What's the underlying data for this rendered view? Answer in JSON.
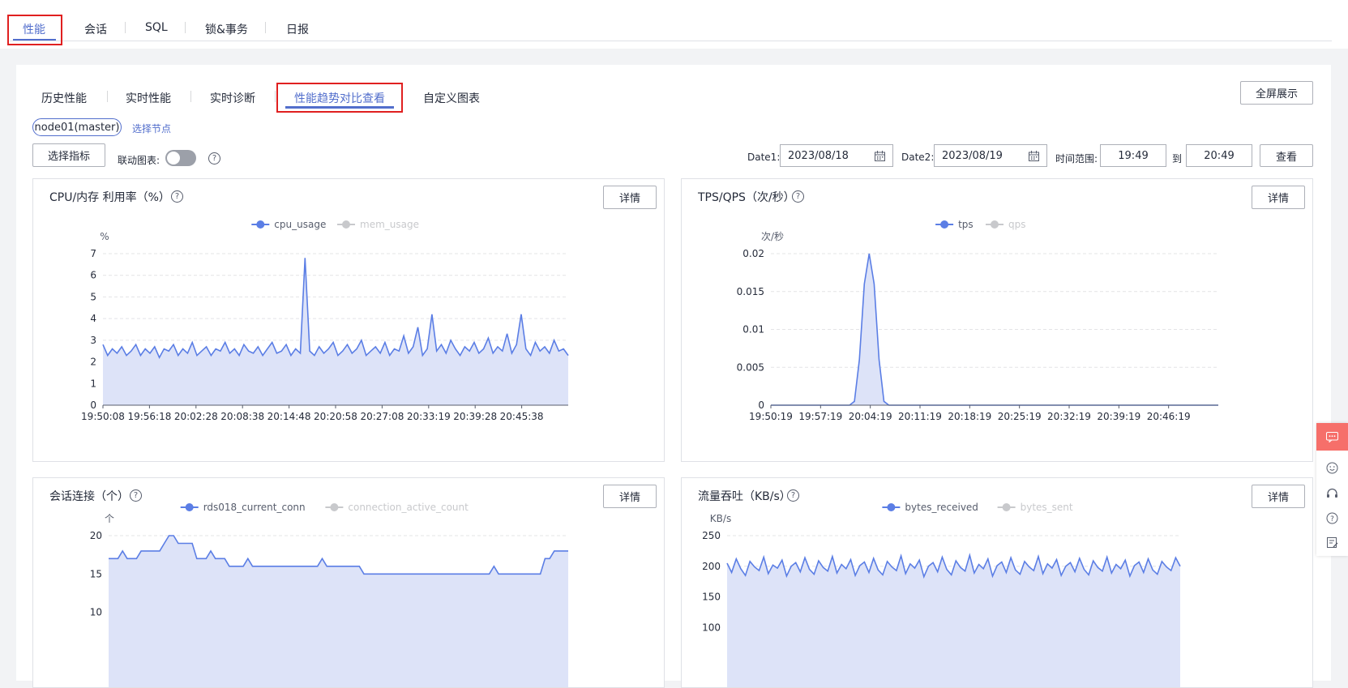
{
  "top_tabs": [
    "性能",
    "会话",
    "SQL",
    "锁&事务",
    "日报"
  ],
  "sub_tabs": [
    "历史性能",
    "实时性能",
    "实时诊断",
    "性能趋势对比查看",
    "自定义图表"
  ],
  "fullscreen_label": "全屏展示",
  "node_tag": "node01(master)",
  "select_node_label": "选择节点",
  "select_metric_label": "选择指标",
  "linked_chart_label": "联动图表:",
  "linked_chart_on": false,
  "date1_label": "Date1:",
  "date1_value": "2023/08/18",
  "date2_label": "Date2:",
  "date2_value": "2023/08/19",
  "time_range_label": "时间范围:",
  "time_from": "19:49",
  "to_label": "到",
  "time_to": "20:49",
  "query_label": "查看",
  "detail_label": "详情",
  "colors": {
    "accent": "#526ecc",
    "series": "#5b7ee5",
    "fill": "#dde3f8",
    "inactive": "#c8c9cc",
    "red_box": "#e02020"
  },
  "cards": [
    {
      "title": "CPU/内存 利用率（%）",
      "legend": [
        "cpu_usage",
        "mem_usage"
      ],
      "unit": "%"
    },
    {
      "title": "TPS/QPS（次/秒）",
      "legend": [
        "tps",
        "qps"
      ],
      "unit": "次/秒"
    },
    {
      "title": "会话连接（个）",
      "legend": [
        "rds018_current_conn",
        "connection_active_count"
      ],
      "unit": "个"
    },
    {
      "title": "流量吞吐（KB/s）",
      "legend": [
        "bytes_received",
        "bytes_sent"
      ],
      "unit": "KB/s"
    }
  ],
  "chart_data": [
    {
      "type": "area",
      "title": "CPU/内存 利用率（%）",
      "ylabel": "%",
      "ylim": [
        0,
        7
      ],
      "yticks": [
        "0",
        "1",
        "2",
        "3",
        "4",
        "5",
        "6",
        "7"
      ],
      "xticks": [
        "19:50:08",
        "19:56:18",
        "20:02:28",
        "20:08:38",
        "20:14:48",
        "20:20:58",
        "20:27:08",
        "20:33:19",
        "20:39:28",
        "20:45:38"
      ],
      "series": [
        {
          "name": "cpu_usage",
          "active": true,
          "values": [
            2.8,
            2.3,
            2.6,
            2.4,
            2.7,
            2.3,
            2.5,
            2.8,
            2.3,
            2.6,
            2.4,
            2.7,
            2.2,
            2.6,
            2.5,
            2.8,
            2.3,
            2.6,
            2.4,
            2.9,
            2.3,
            2.5,
            2.7,
            2.3,
            2.6,
            2.5,
            2.9,
            2.4,
            2.6,
            2.3,
            2.8,
            2.5,
            2.4,
            2.7,
            2.3,
            2.6,
            2.9,
            2.4,
            2.5,
            2.8,
            2.3,
            2.6,
            2.4,
            6.8,
            2.5,
            2.3,
            2.7,
            2.4,
            2.6,
            2.9,
            2.3,
            2.5,
            2.8,
            2.4,
            2.6,
            3.0,
            2.3,
            2.5,
            2.7,
            2.4,
            2.9,
            2.3,
            2.6,
            2.5,
            3.2,
            2.4,
            2.7,
            3.6,
            2.3,
            2.6,
            4.2,
            2.5,
            2.8,
            2.4,
            3.0,
            2.6,
            2.3,
            2.7,
            2.5,
            2.9,
            2.4,
            2.6,
            3.1,
            2.4,
            2.7,
            2.5,
            3.3,
            2.4,
            2.8,
            4.2,
            2.6,
            2.3,
            2.9,
            2.5,
            2.7,
            2.4,
            3.0,
            2.5,
            2.6,
            2.3
          ]
        },
        {
          "name": "mem_usage",
          "active": false,
          "values": []
        }
      ]
    },
    {
      "type": "area",
      "title": "TPS/QPS（次/秒）",
      "ylabel": "次/秒",
      "ylim": [
        0,
        0.02
      ],
      "yticks": [
        "0",
        "0.005",
        "0.01",
        "0.015",
        "0.02"
      ],
      "xticks": [
        "19:50:19",
        "19:57:19",
        "20:04:19",
        "20:11:19",
        "20:18:19",
        "20:25:19",
        "20:32:19",
        "20:39:19",
        "20:46:19"
      ],
      "series": [
        {
          "name": "tps",
          "active": true,
          "values": [
            0,
            0,
            0,
            0,
            0,
            0,
            0,
            0,
            0,
            0,
            0,
            0,
            0,
            0,
            0,
            0,
            0,
            0.0005,
            0.006,
            0.016,
            0.02,
            0.016,
            0.006,
            0.0005,
            0,
            0,
            0,
            0,
            0,
            0,
            0,
            0,
            0,
            0,
            0,
            0,
            0,
            0,
            0,
            0,
            0,
            0,
            0,
            0,
            0,
            0,
            0,
            0,
            0,
            0,
            0,
            0,
            0,
            0,
            0,
            0,
            0,
            0,
            0,
            0,
            0,
            0,
            0,
            0,
            0,
            0,
            0,
            0,
            0,
            0,
            0,
            0,
            0,
            0,
            0,
            0,
            0,
            0,
            0,
            0,
            0,
            0,
            0,
            0,
            0,
            0,
            0,
            0,
            0,
            0,
            0,
            0
          ]
        },
        {
          "name": "qps",
          "active": false,
          "values": []
        }
      ]
    },
    {
      "type": "area",
      "title": "会话连接（个）",
      "ylabel": "个",
      "ylim": [
        0,
        20
      ],
      "yticks": [
        "10",
        "15",
        "20"
      ],
      "xticks": [],
      "series": [
        {
          "name": "rds018_current_conn",
          "active": true,
          "values": [
            17,
            17,
            17,
            18,
            17,
            17,
            17,
            18,
            18,
            18,
            18,
            18,
            19,
            20,
            20,
            19,
            19,
            19,
            19,
            17,
            17,
            17,
            18,
            17,
            17,
            17,
            16,
            16,
            16,
            16,
            17,
            16,
            16,
            16,
            16,
            16,
            16,
            16,
            16,
            16,
            16,
            16,
            16,
            16,
            16,
            16,
            17,
            16,
            16,
            16,
            16,
            16,
            16,
            16,
            16,
            15,
            15,
            15,
            15,
            15,
            15,
            15,
            15,
            15,
            15,
            15,
            15,
            15,
            15,
            15,
            15,
            15,
            15,
            15,
            15,
            15,
            15,
            15,
            15,
            15,
            15,
            15,
            15,
            16,
            15,
            15,
            15,
            15,
            15,
            15,
            15,
            15,
            15,
            15,
            17,
            17,
            18,
            18,
            18,
            18
          ]
        },
        {
          "name": "connection_active_count",
          "active": false,
          "values": []
        }
      ]
    },
    {
      "type": "area",
      "title": "流量吞吐（KB/s）",
      "ylabel": "KB/s",
      "ylim": [
        0,
        250
      ],
      "yticks": [
        "100",
        "150",
        "200",
        "250"
      ],
      "xticks": [],
      "series": [
        {
          "name": "bytes_received",
          "active": true,
          "values": [
            205,
            190,
            212,
            196,
            185,
            208,
            199,
            193,
            215,
            188,
            202,
            197,
            210,
            184,
            200,
            206,
            191,
            214,
            195,
            187,
            209,
            198,
            192,
            216,
            189,
            203,
            196,
            211,
            185,
            201,
            207,
            190,
            213,
            194,
            186,
            208,
            199,
            193,
            217,
            188,
            204,
            197,
            210,
            183,
            200,
            206,
            191,
            215,
            195,
            186,
            209,
            198,
            192,
            218,
            189,
            203,
            196,
            212,
            184,
            201,
            207,
            190,
            214,
            194,
            187,
            208,
            199,
            193,
            216,
            188,
            204,
            197,
            211,
            185,
            200,
            206,
            191,
            213,
            195,
            186,
            209,
            198,
            192,
            215,
            189,
            203,
            196,
            210,
            184,
            201,
            207,
            190,
            212,
            194,
            187,
            208,
            199,
            193,
            214,
            200
          ]
        },
        {
          "name": "bytes_sent",
          "active": false,
          "values": []
        }
      ]
    }
  ]
}
